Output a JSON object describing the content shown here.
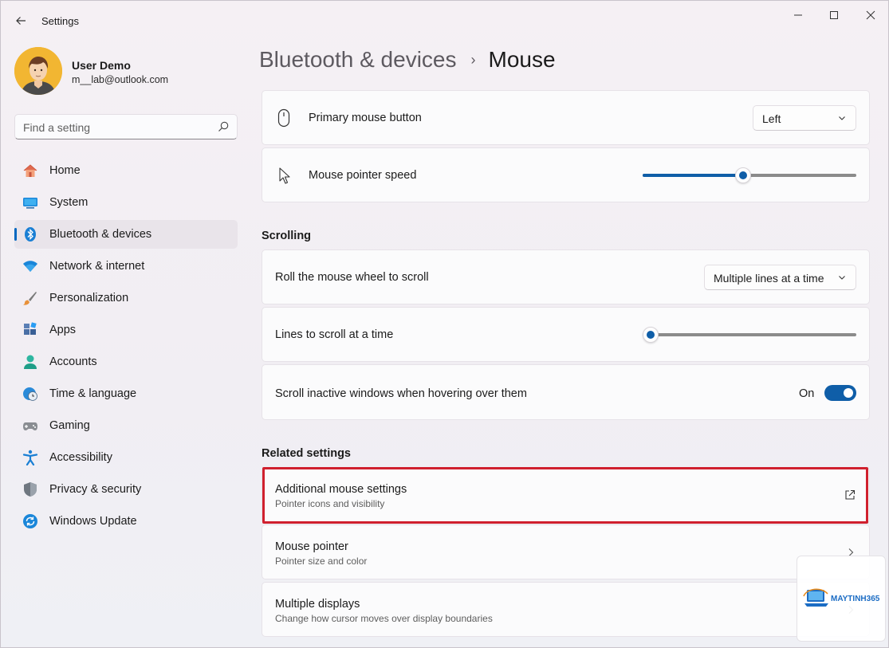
{
  "window": {
    "title": "Settings"
  },
  "profile": {
    "name": "User Demo",
    "email": "m__lab@outlook.com"
  },
  "search": {
    "placeholder": "Find a setting",
    "value": ""
  },
  "nav": {
    "items": [
      {
        "label": "Home",
        "icon": "home-icon"
      },
      {
        "label": "System",
        "icon": "monitor-icon"
      },
      {
        "label": "Bluetooth & devices",
        "icon": "bluetooth-icon",
        "selected": true
      },
      {
        "label": "Network & internet",
        "icon": "wifi-icon"
      },
      {
        "label": "Personalization",
        "icon": "brush-icon"
      },
      {
        "label": "Apps",
        "icon": "apps-icon"
      },
      {
        "label": "Accounts",
        "icon": "person-icon"
      },
      {
        "label": "Time & language",
        "icon": "globe-clock-icon"
      },
      {
        "label": "Gaming",
        "icon": "gamepad-icon"
      },
      {
        "label": "Accessibility",
        "icon": "accessibility-icon"
      },
      {
        "label": "Privacy & security",
        "icon": "shield-icon"
      },
      {
        "label": "Windows Update",
        "icon": "update-icon"
      }
    ]
  },
  "header": {
    "parent": "Bluetooth & devices",
    "separator": "›",
    "current": "Mouse"
  },
  "main": {
    "primary_button": {
      "label": "Primary mouse button",
      "value": "Left"
    },
    "pointer_speed": {
      "label": "Mouse pointer speed",
      "level": 0.47
    },
    "scrolling": {
      "heading": "Scrolling",
      "roll_wheel": {
        "label": "Roll the mouse wheel to scroll",
        "value": "Multiple lines at a time"
      },
      "lines": {
        "label": "Lines to scroll at a time",
        "level": 0.03
      },
      "inactive": {
        "label": "Scroll inactive windows when hovering over them",
        "state": "On",
        "on": true
      }
    },
    "related": {
      "heading": "Related settings",
      "items": [
        {
          "title": "Additional mouse settings",
          "subtitle": "Pointer icons and visibility",
          "icon": "external-link-icon"
        },
        {
          "title": "Mouse pointer",
          "subtitle": "Pointer size and color",
          "icon": "chevron-right-icon"
        },
        {
          "title": "Multiple displays",
          "subtitle": "Change how cursor moves over display boundaries",
          "icon": "chevron-right-icon"
        }
      ]
    }
  },
  "watermark": {
    "brand": "MAYTINH365"
  },
  "colors": {
    "accent": "#0f5ea8",
    "highlight": "#d0202e"
  }
}
